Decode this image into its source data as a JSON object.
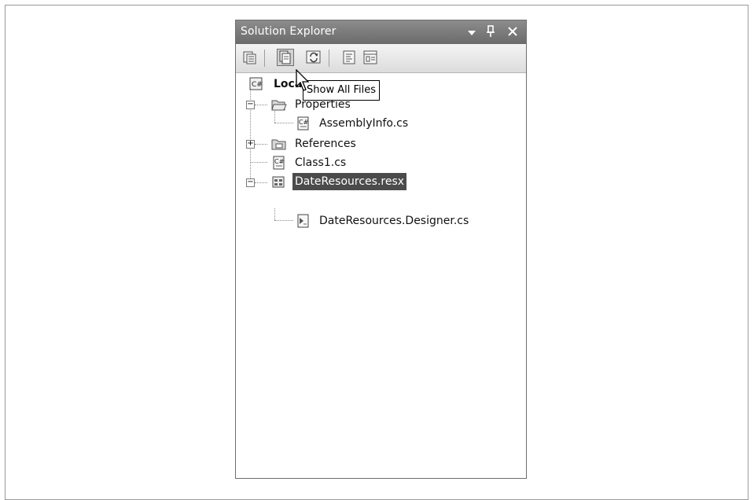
{
  "panel": {
    "title": "Solution Explorer",
    "controls": {
      "dropdown": "▾",
      "pin": "ᵦ",
      "close": "✕"
    }
  },
  "toolbar": {
    "tools": [
      {
        "name": "properties-tool",
        "icon": "properties-icon"
      },
      {
        "name": "show-all-files-tool",
        "icon": "show-all-files-icon",
        "pressed": true
      },
      {
        "name": "refresh-tool",
        "icon": "refresh-icon"
      },
      {
        "name": "view-code-tool",
        "icon": "view-code-icon"
      },
      {
        "name": "view-designer-tool",
        "icon": "view-designer-icon"
      }
    ]
  },
  "tooltip": {
    "text": "Show All Files"
  },
  "tree": {
    "root": "Loca",
    "properties": "Properties",
    "assembly_info": "AssemblyInfo.cs",
    "references": "References",
    "class1": "Class1.cs",
    "date_resources": "DateResources.resx",
    "date_resources_designer": "DateResources.Designer.cs"
  },
  "colors": {
    "title_bar": "#7a7a7a",
    "selection": "#4b4b4b"
  }
}
